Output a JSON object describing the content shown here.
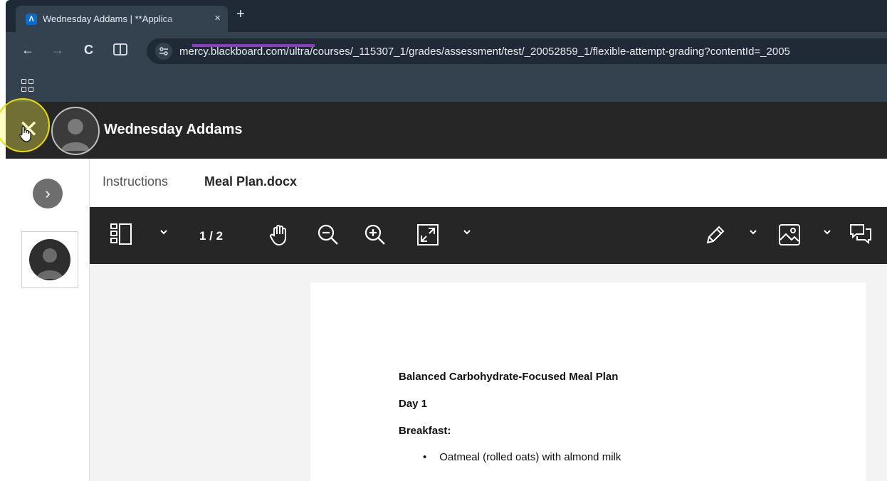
{
  "browser": {
    "tab_title": "Wednesday Addams | **Applica",
    "tab_close": "×",
    "new_tab": "+",
    "url": "mercy.blackboard.com/ultra/courses/_115307_1/grades/assessment/test/_20052859_1/flexible-attempt-grading?contentId=_2005",
    "favicon_letter": "Λ",
    "back_icon": "←",
    "forward_icon": "→",
    "reload_icon": "C"
  },
  "header": {
    "close_glyph": "✕",
    "user_name": "Wednesday Addams"
  },
  "rail": {
    "expand_glyph": "›"
  },
  "tabs": {
    "instructions": "Instructions",
    "file": "Meal Plan.docx"
  },
  "doc_toolbar": {
    "page_indicator": "1 / 2"
  },
  "document": {
    "title": "Balanced Carbohydrate-Focused Meal Plan",
    "day": "Day 1",
    "section": "Breakfast:",
    "items": [
      "Oatmeal (rolled oats) with almond milk"
    ]
  },
  "colors": {
    "browser_dark": "#1f2a36",
    "browser_toolbar": "#34414f",
    "app_header": "#262626",
    "tab_accent": "#8c3cbf",
    "cursor_highlight": "#e6df00"
  }
}
